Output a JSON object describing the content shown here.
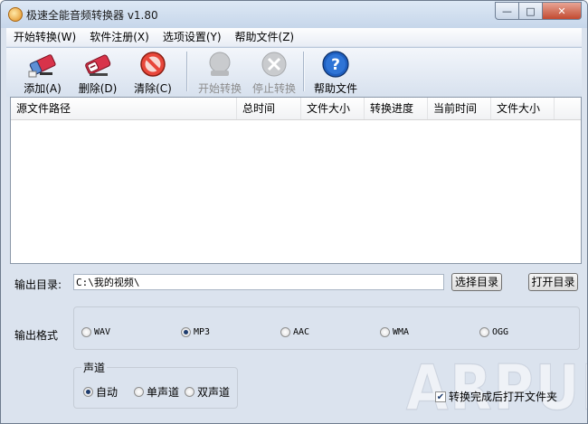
{
  "window": {
    "title": "极速全能音频转换器 v1.80",
    "min_glyph": "—",
    "max_glyph": "□",
    "close_glyph": "✕"
  },
  "menu": {
    "items": [
      "开始转换(W)",
      "软件注册(X)",
      "选项设置(Y)",
      "帮助文件(Z)"
    ]
  },
  "toolbar": {
    "add": {
      "label": "添加(A)",
      "icon": "add-eraser-icon",
      "enabled": true
    },
    "delete": {
      "label": "删除(D)",
      "icon": "delete-eraser-icon",
      "enabled": true
    },
    "clear": {
      "label": "清除(C)",
      "icon": "clear-no-icon",
      "enabled": true
    },
    "start": {
      "label": "开始转换",
      "icon": "start-convert-icon",
      "enabled": false
    },
    "stop": {
      "label": "停止转换",
      "icon": "stop-convert-icon",
      "enabled": false
    },
    "help": {
      "label": "帮助文件",
      "icon": "help-icon",
      "enabled": true
    }
  },
  "filelist": {
    "columns": [
      "源文件路径",
      "总时间",
      "文件大小",
      "转换进度",
      "当前时间",
      "文件大小"
    ],
    "rows": []
  },
  "output": {
    "dir_label": "输出目录:",
    "dir_value": "C:\\我的视频\\",
    "choose_button": "选择目录",
    "open_button": "打开目录",
    "format_label": "输出格式",
    "formats": [
      "WAV",
      "MP3",
      "AAC",
      "WMA",
      "OGG"
    ],
    "selected_format": "MP3"
  },
  "channel": {
    "group_title": "声道",
    "options": [
      "自动",
      "单声道",
      "双声道"
    ],
    "selected": "自动"
  },
  "open_folder_after": {
    "label": "转换完成后打开文件夹",
    "checked": true
  },
  "watermark": "ARPUN",
  "colors": {
    "window_bg": "#dbe3ee",
    "close_button": "#c24a31",
    "help_blue": "#1f5fbf",
    "eraser_red": "#d8334a"
  }
}
